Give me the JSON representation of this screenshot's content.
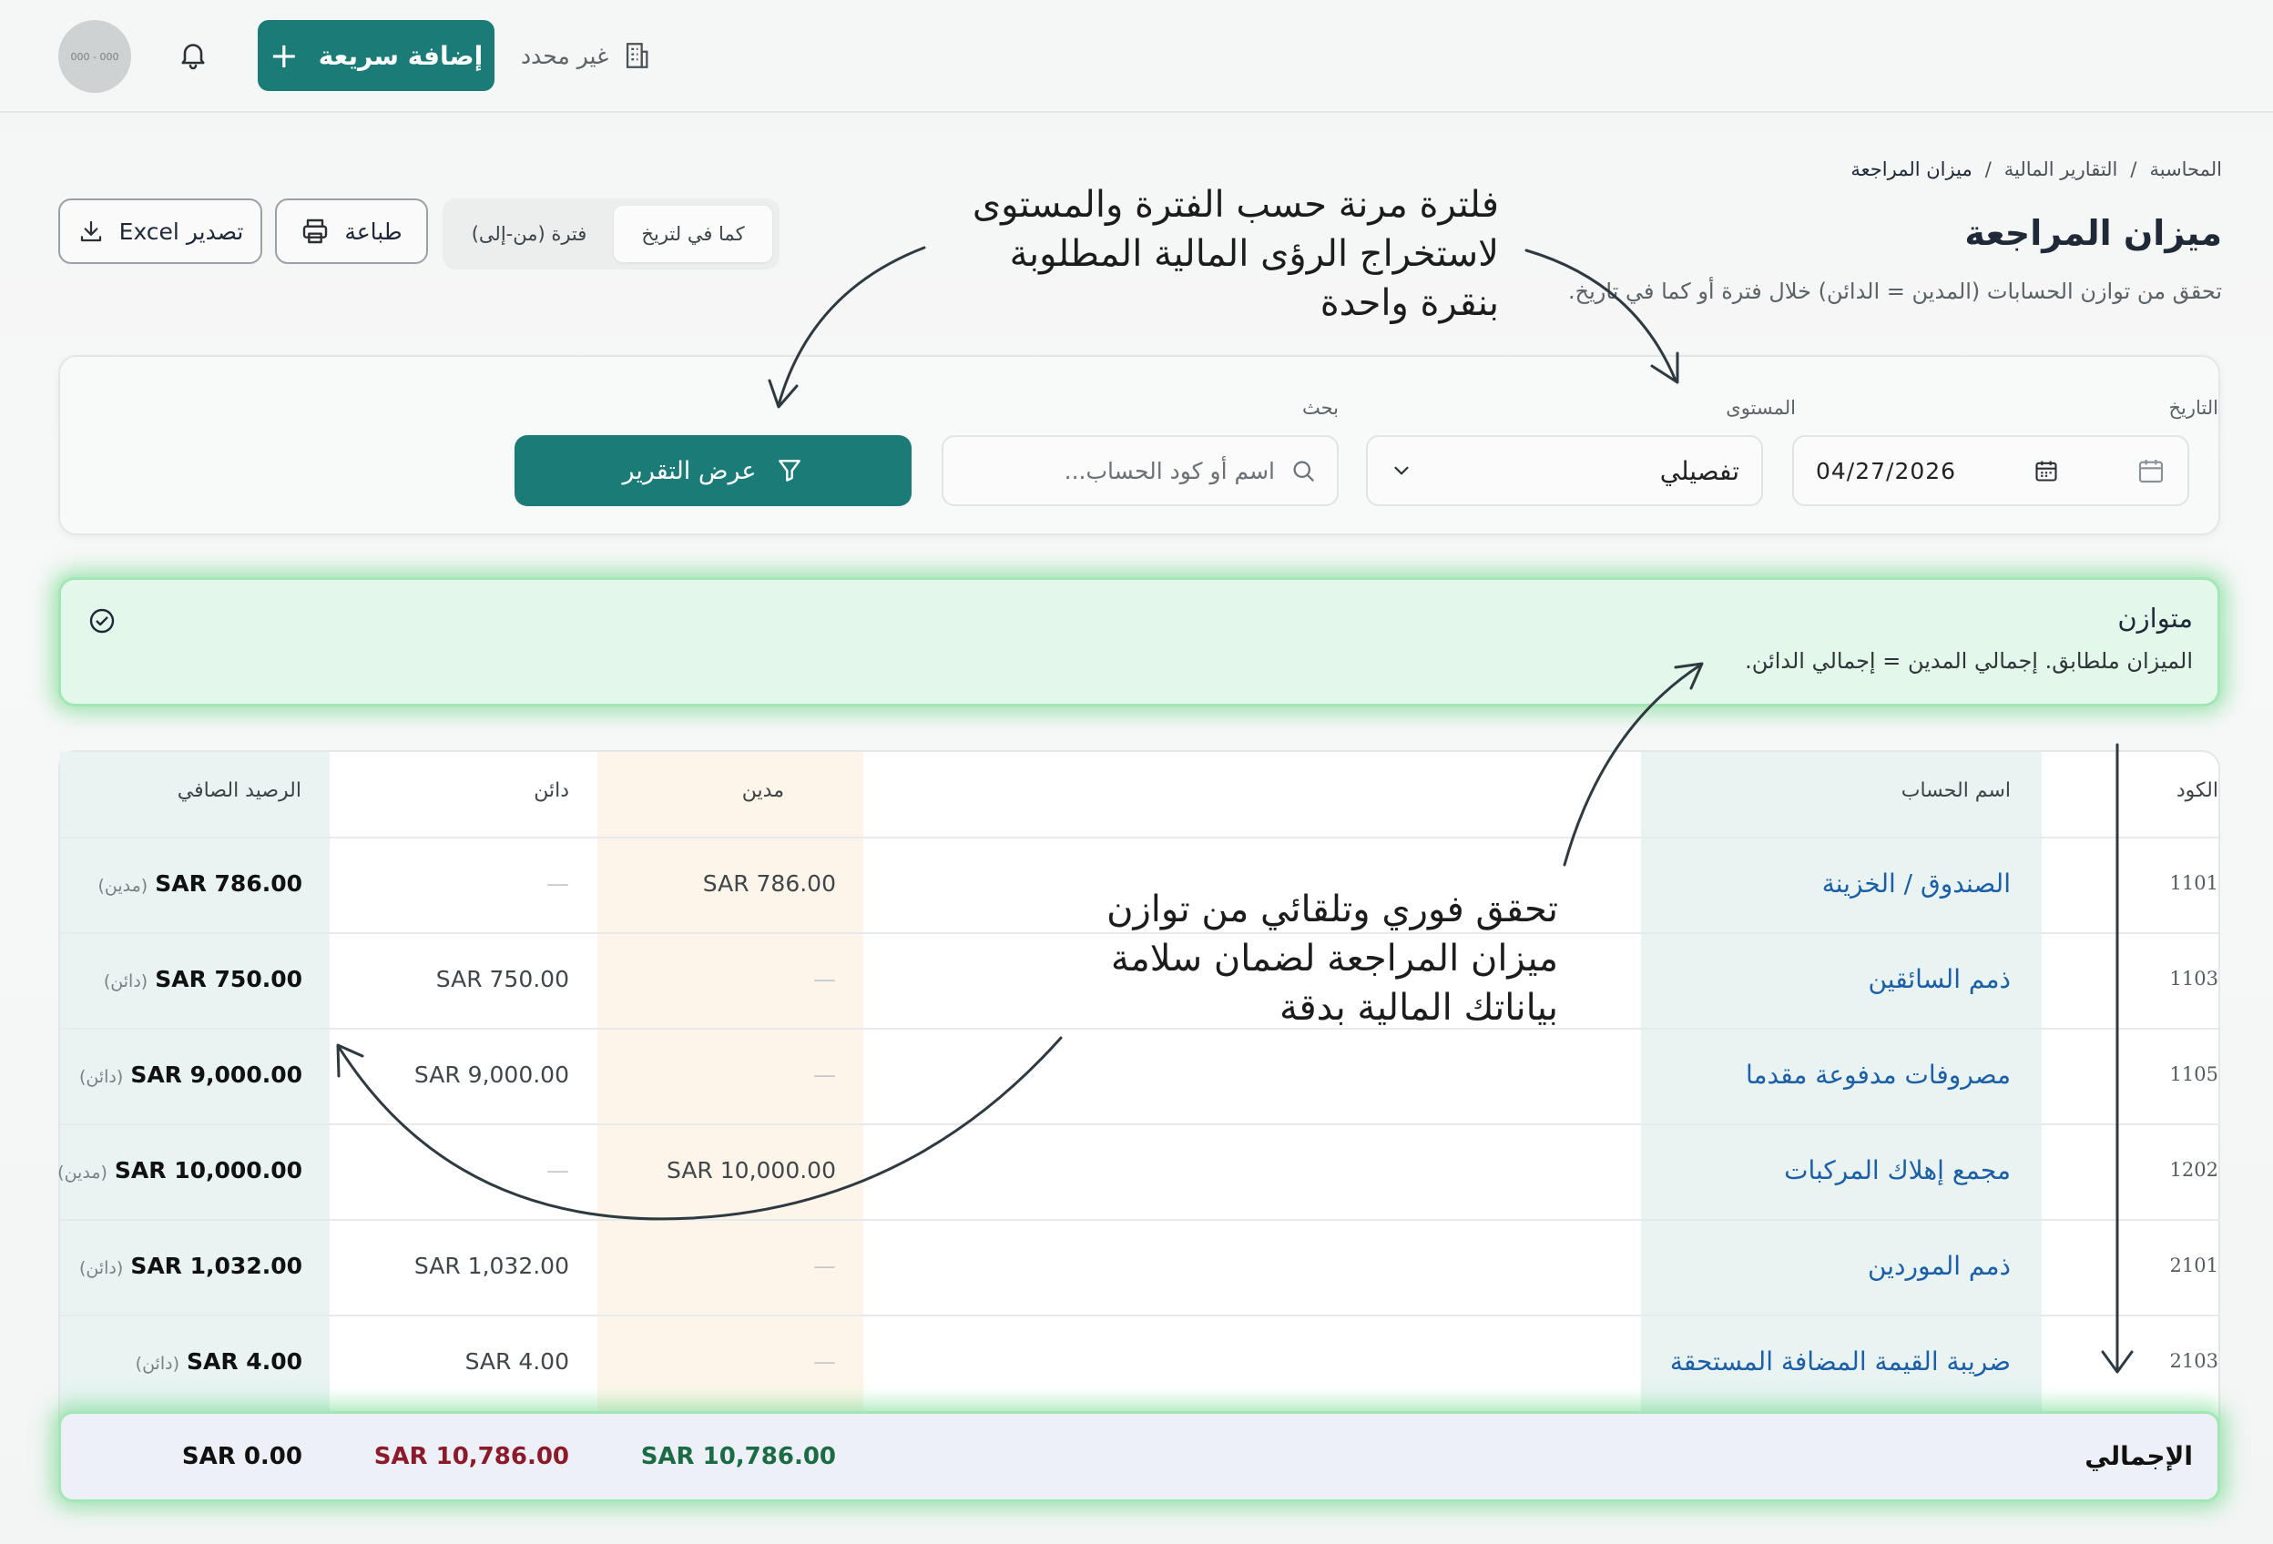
{
  "topbar": {
    "avatar_text": "000 - 000",
    "quick_add_label": "إضافة سريعة",
    "branch_label": "غير محدد"
  },
  "breadcrumb": [
    "المحاسبة",
    "التقارير المالية",
    "ميزان المراجعة"
  ],
  "page": {
    "title": "ميزان المراجعة",
    "subtitle": "تحقق من توازن الحسابات (المدين = الدائن) خلال فترة أو كما في تاريخ."
  },
  "actions": {
    "excel_label": "تصدير Excel",
    "print_label": "طباعة",
    "mode_options": [
      "كما في لتريخ",
      "فترة (من-إلى)"
    ],
    "mode_selected": "كما في لتريخ"
  },
  "annotations": {
    "filter_note": [
      "فلترة مرنة حسب الفترة والمستوى",
      "لاستخراج الرؤى المالية المطلوبة",
      "بنقرة واحدة"
    ],
    "balance_note": [
      "تحقق فوري وتلقائي من توازن",
      "ميزان المراجعة لضمان سلامة",
      "بياناتك المالية بدقة"
    ]
  },
  "filters": {
    "date_label": "التاريخ",
    "date_value": "04/27/2026",
    "level_label": "المستوى",
    "level_value": "تفصيلي",
    "search_label": "بحث",
    "search_placeholder": "اسم أو كود الحساب...",
    "submit_label": "عرض التقرير"
  },
  "status": {
    "title": "متوازن",
    "message": "الميزان ملطابق. إجمالي المدين = إجمالي الدائن."
  },
  "table": {
    "headers": {
      "code": "الكود",
      "name": "اسم الحساب",
      "debit": "مدين",
      "credit": "دائن",
      "net": "الرصيد الصافي"
    },
    "rows": [
      {
        "code": "1101",
        "name": "الصندوق / الخزينة",
        "debit": "SAR 786.00",
        "credit": "—",
        "net": "SAR 786.00",
        "side": "(مدين)"
      },
      {
        "code": "1103",
        "name": "ذمم السائقين",
        "debit": "—",
        "credit": "SAR 750.00",
        "net": "SAR 750.00",
        "side": "(دائن)"
      },
      {
        "code": "1105",
        "name": "مصروفات مدفوعة مقدما",
        "debit": "—",
        "credit": "SAR 9,000.00",
        "net": "SAR 9,000.00",
        "side": "(دائن)"
      },
      {
        "code": "1202",
        "name": "مجمع إهلاك المركبات",
        "debit": "SAR 10,000.00",
        "credit": "—",
        "net": "SAR 10,000.00",
        "side": "(مدين)"
      },
      {
        "code": "2101",
        "name": "ذمم الموردين",
        "debit": "—",
        "credit": "SAR 1,032.00",
        "net": "SAR 1,032.00",
        "side": "(دائن)"
      },
      {
        "code": "2103",
        "name": "ضريبة القيمة المضافة المستحقة",
        "debit": "—",
        "credit": "SAR 4.00",
        "net": "SAR 4.00",
        "side": "(دائن)"
      }
    ],
    "total": {
      "label": "الإجمالي",
      "debit": "SAR 10,786.00",
      "credit": "SAR 10,786.00",
      "net": "SAR 0.00"
    }
  },
  "colors": {
    "brand": "#1b7b77",
    "link": "#1d5fa6",
    "debit_total": "#1b6b45",
    "credit_total": "#8b1a2b",
    "balanced_bg": "#e3f7ea",
    "balanced_glow": "#60d680"
  },
  "icons": [
    "bell-icon",
    "plus-icon",
    "building-icon",
    "download-icon",
    "printer-icon",
    "calendar-icon",
    "chevron-down-icon",
    "search-icon",
    "filter-icon",
    "check-circle-icon"
  ]
}
